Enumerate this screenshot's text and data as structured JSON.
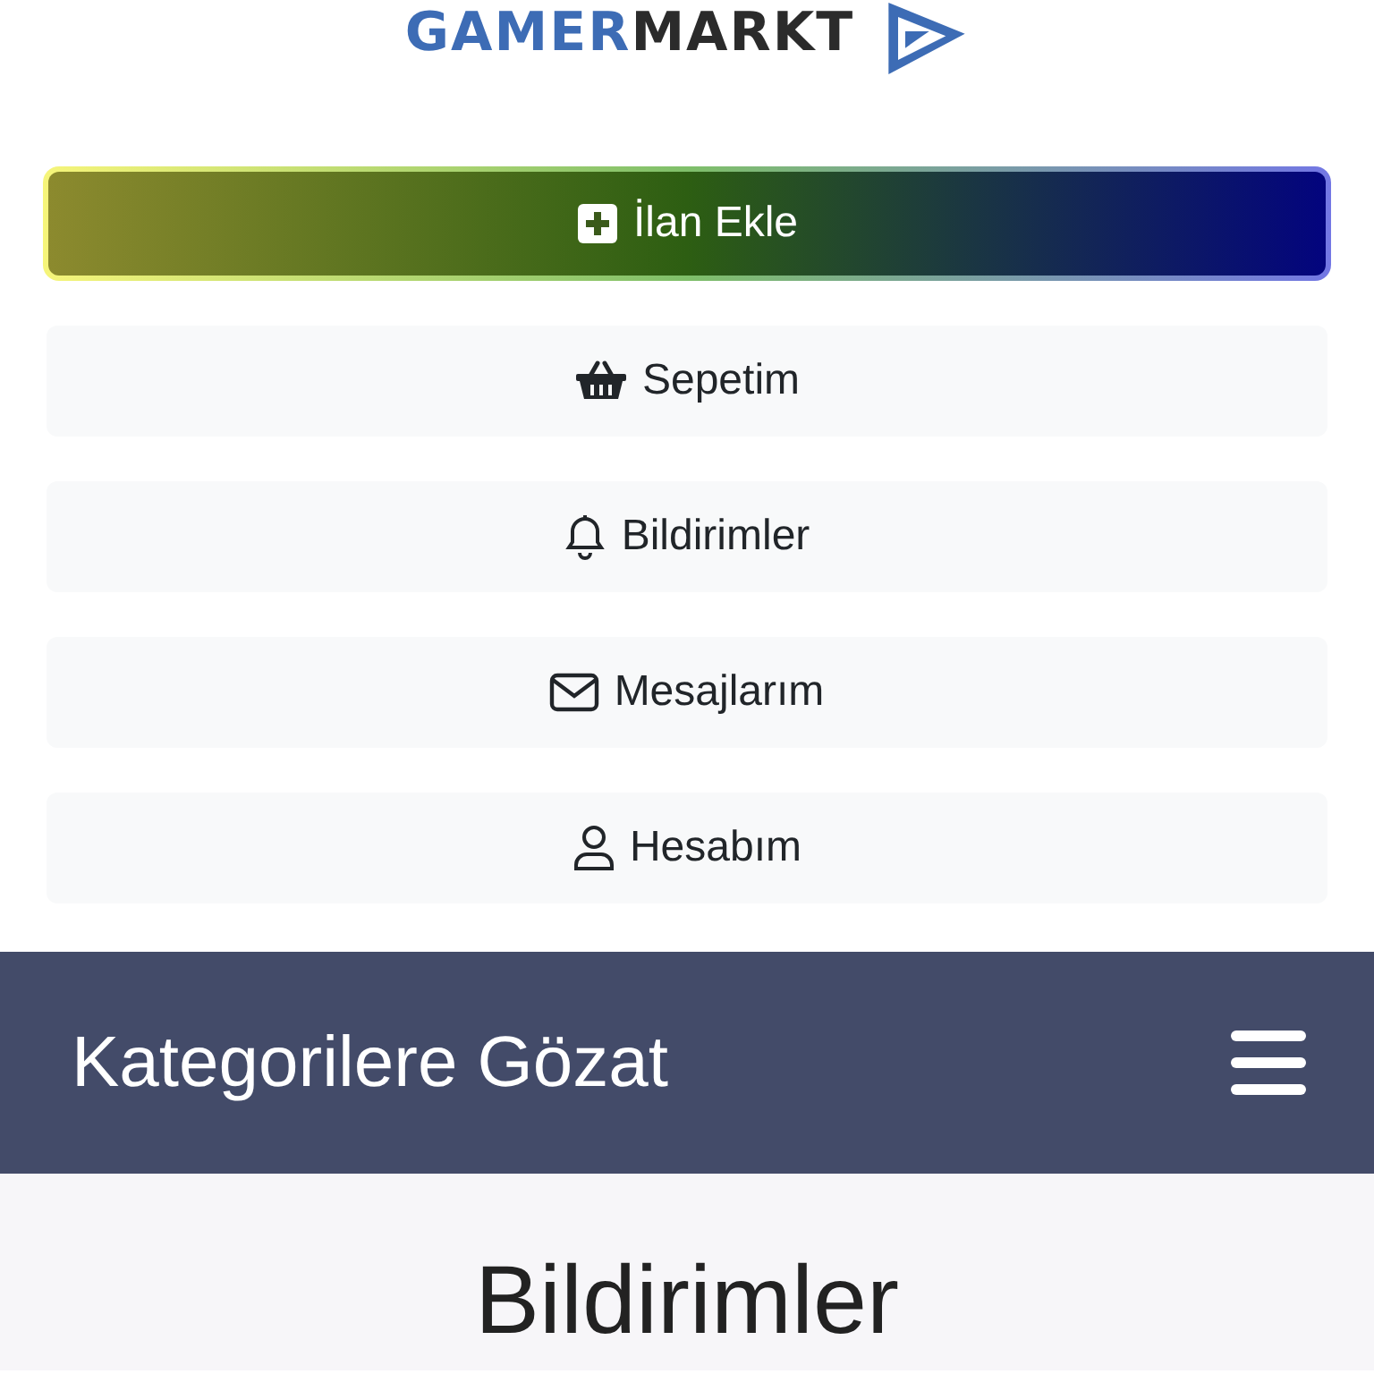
{
  "logo": {
    "part_1": "GAMER",
    "part_2": "MARKT"
  },
  "primary_button": {
    "label": "İlan Ekle",
    "kind": "plus"
  },
  "menu_buttons": [
    {
      "label": "Sepetim",
      "kind": "basket"
    },
    {
      "label": "Bildirimler",
      "kind": "bell"
    },
    {
      "label": "Mesajlarım",
      "kind": "envelope"
    },
    {
      "label": "Hesabım",
      "kind": "person"
    }
  ],
  "navbar": {
    "title": "Kategorilere Gözat"
  },
  "page_heading": "Bildirimler"
}
